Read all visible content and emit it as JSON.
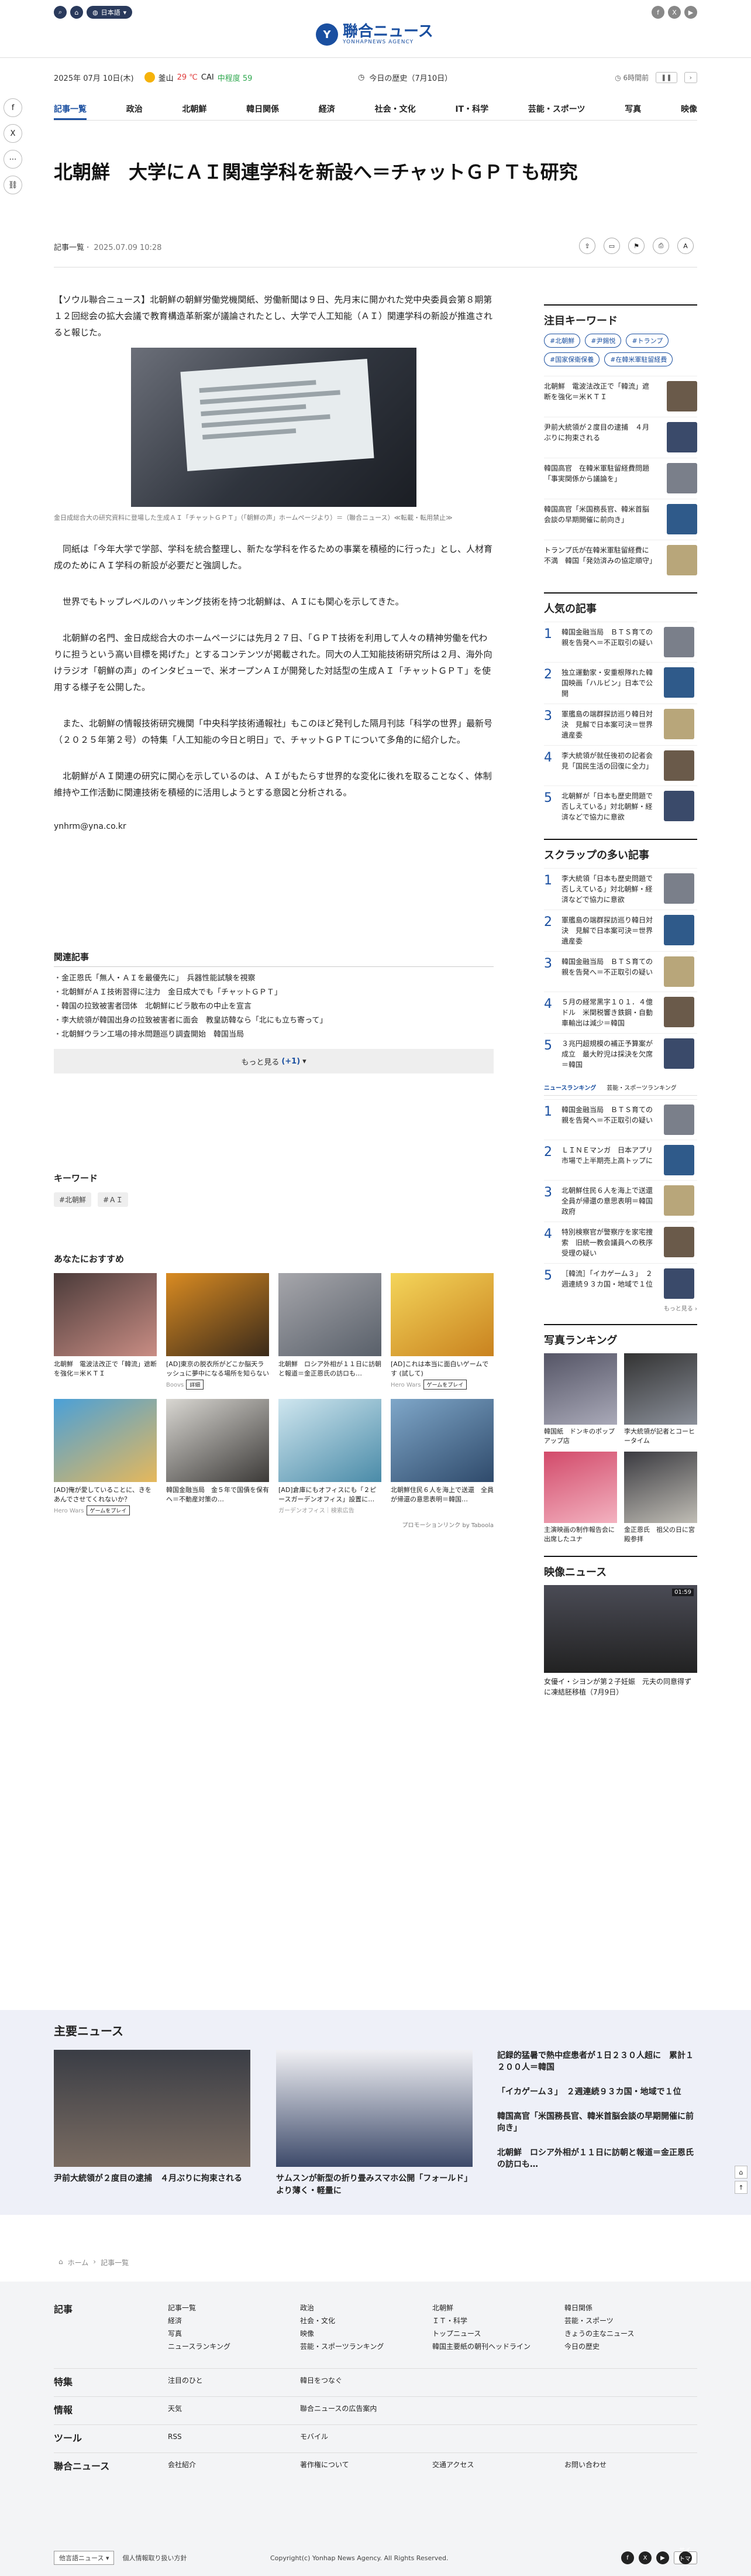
{
  "header": {
    "lang_label": "日本語",
    "logo_text": "聯合ニュース",
    "logo_sub": "YONHAPNEWS AGENCY",
    "date": "2025年 07月 10日(木)",
    "weather_label": "釜山",
    "temp": "29 ℃",
    "cai_label": "CAI",
    "cai_status": "中程度 59",
    "today_history": "今日の歴史（7月10日）",
    "updated": "6時間前"
  },
  "nav": [
    "記事一覧",
    "政治",
    "北朝鮮",
    "韓日関係",
    "経済",
    "社会・文化",
    "IT・科学",
    "芸能・スポーツ",
    "写真",
    "映像"
  ],
  "article": {
    "title": "北朝鮮　大学にＡＩ関連学科を新設へ＝チャットＧＰＴも研究",
    "category": "記事一覧",
    "datetime": "2025.07.09 10:28",
    "lead": "【ソウル聯合ニュース】北朝鮮の朝鮮労働党機関紙、労働新聞は９日、先月末に開かれた党中央委員会第８期第１２回総会の拡大会議で教育構造革新案が議論されたとし、大学で人工知能（ＡＩ）関連学科の新設が推進されると報じた。",
    "caption": "金日成総合大の研究資料に登場した生成ＡＩ「チャットＧＰＴ」（「朝鮮の声」ホームページより）＝（聯合ニュース）≪転載・転用禁止≫",
    "p1": "　同紙は「今年大学で学部、学科を統合整理し、新たな学科を作るための事業を積極的に行った」とし、人材育成のためにＡＩ学科の新設が必要だと強調した。",
    "p2": "　世界でもトップレベルのハッキング技術を持つ北朝鮮は、ＡＩにも関心を示してきた。",
    "p3": "　北朝鮮の名門、金日成総合大のホームページには先月２７日、「ＧＰＴ技術を利用して人々の精神労働を代わりに担うという高い目標を掲げた」とするコンテンツが掲載された。同大の人工知能技術研究所は２月、海外向けラジオ「朝鮮の声」のインタビューで、米オープンＡＩが開発した対話型の生成ＡＩ「チャットＧＰＴ」を使用する様子を公開した。",
    "p4": "　また、北朝鮮の情報技術研究機関「中央科学技術通報社」もこのほど発刊した隔月刊誌「科学の世界」最新号（２０２５年第２号）の特集「人工知能の今日と明日」で、チャットＧＰＴについて多角的に紹介した。",
    "p5": "　北朝鮮がＡＩ関連の研究に関心を示しているのは、ＡＩがもたらす世界的な変化に後れを取ることなく、体制維持や工作活動に関連技術を積極的に活用しようとする意図と分析される。",
    "email": "ynhrm@yna.co.kr"
  },
  "related": {
    "heading": "関連記事",
    "items": [
      "金正恩氏「無人・ＡＩを最優先に」　兵器性能試験を視察",
      "北朝鮮がＡＩ技術習得に注力　金日成大でも「チャットＧＰＴ」",
      "韓国の拉致被害者団体　北朝鮮にビラ散布の中止を宣言",
      "李大統領が韓国出身の拉致被害者に面会　教皇訪韓なら「北にも立ち寄って」",
      "北朝鮮ウラン工場の排水問題巡り調査開始　韓国当局"
    ],
    "more_label": "もっと見る",
    "more_count": "(+1)"
  },
  "keywords": {
    "heading": "キーワード",
    "items": [
      "#北朝鮮",
      "#ＡＩ"
    ]
  },
  "recommend": {
    "heading": "あなたにおすすめ",
    "promo": "プロモーションリンク by Taboola",
    "items": [
      {
        "t": "北朝鮮　電波法改正で「韓流」遮断を強化＝米ＫＴＩ",
        "s": "",
        "btn": ""
      },
      {
        "t": "[AD]東京の脱衣所がどこか脳天ラッシュに夢中になる場所を知らない",
        "s": "Boovs",
        "btn": "詳細"
      },
      {
        "t": "北朝鮮　ロシア外相が１１日に訪朝と報道＝金正恩氏の訪ロも…",
        "s": "",
        "btn": ""
      },
      {
        "t": "[AD]これは本当に面白いゲームです (試して)",
        "s": "Hero Wars",
        "btn": "ゲームをプレイ"
      },
      {
        "t": "[AD]俺が愛していることに、きをあんでさせてくれないか？",
        "s": "Hero Wars",
        "btn": "ゲームをプレイ"
      },
      {
        "t": "韓国金融当局　金５年で国債を保有へ＝不動産対策の…",
        "s": "",
        "btn": ""
      },
      {
        "t": "[AD]倉庫にもオフィスにも「２ピースガーデンオフィス」設置に…",
        "s": "ガーデンオフィス｜検索広告",
        "btn": ""
      },
      {
        "t": "北朝鮮住民６人を海上で送還　全員が帰還の意思表明＝韓国…",
        "s": "",
        "btn": ""
      }
    ]
  },
  "side": {
    "kw_heading": "注目キーワード",
    "tags": [
      "#北朝鮮",
      "#尹錫悦",
      "#トランプ",
      "#国家保衛保養",
      "#在韓米軍駐留経費"
    ],
    "kw_items": [
      "北朝鮮　電波法改正で「韓流」遮断を強化＝米ＫＴＩ",
      "尹前大統領が２度目の逮捕　４月ぶりに拘束される",
      "韓国高官　在韓米軍駐留経費問題「事実関係から議論を」",
      "韓国高官「米国務長官、韓米首脳会談の早期開催に前向き」",
      "トランプ氏が在韓米軍駐留経費に不満　韓国「発効済みの協定順守」"
    ],
    "pop_heading": "人気の記事",
    "popular": [
      "韓国金融当局　ＢＴＳ育ての親を告発へ＝不正取引の疑い",
      "独立運動家・安重根隊れた韓国映画「ハルビン」日本で公開",
      "軍艦島の端群探訪巡り韓日対決　見解で日本案可決＝世界遺産委",
      "李大統領が就任後初の記者会見「国民生活の回復に全力」",
      "北朝鮮が「日本も歴史問題で否しえている」対北朝鮮・経済などで協力に意欲"
    ],
    "scrap_heading": "スクラップの多い記事",
    "scrap": [
      "李大統領「日本も歴史問題で否しえている」対北朝鮮・経済などで協力に意欲",
      "軍艦島の端群探訪巡り韓日対決　見解で日本案可決＝世界遺産委",
      "韓国金融当局　ＢＴＳ育ての親を告発へ＝不正取引の疑い",
      "５月の経常黒字１０１．４億ドル　米関税響き鉄鋼・自動車輸出は減少＝韓国",
      "３兆円超規模の補正予算案が成立　最大貯児は採決を欠席＝韓国"
    ],
    "tab_news": "ニュースランキング",
    "tab_sports": "芸能・スポーツランキング",
    "ranking": [
      "韓国金融当局　ＢＴＳ育ての親を告発へ＝不正取引の疑い",
      "ＬＩＮＥマンガ　日本アプリ市場で上半期売上高トップに",
      "北朝鮮住民６人を海上で送還　全員が帰還の意思表明＝韓国政府",
      "特別検察官が警察庁を家宅捜索　旧統一教会議員への秩序受理の疑い",
      "［韓流］「イカゲーム３」　２週連続９３カ国・地域で１位"
    ],
    "more_link": "もっと見る",
    "photo_heading": "写真ランキング",
    "photos": [
      "韓国紙　ドンキのポップアップ店",
      "李大統領が記者とコーヒータイム",
      "主演映画の制作報告会に出席したユナ",
      "金正恩氏　祖父の日に宮殿参拝"
    ],
    "video_heading": "映像ニュース",
    "video_dur": "01:59",
    "video_title": "女優イ・シヨンが第２子妊娠　元夫の同意得ずに凍結胚移植（7月9日）"
  },
  "main_news": {
    "heading": "主要ニュース",
    "cards": [
      "尹前大統領が２度目の逮捕　４月ぶりに拘束される",
      "サムスンが新型の折り畳みスマホ公開「フォールド」より薄く・軽量に"
    ],
    "list": [
      "記録的猛暑で熱中症患者が１日２３０人超に　累計１２００人＝韓国",
      "「イカゲーム３」　２週連続９３カ国・地域で１位",
      "韓国高官「米国務長官、韓米首脳会談の早期開催に前向き」",
      "北朝鮮　ロシア外相が１１日に訪朝と報道＝金正恩氏の訪ロも…"
    ]
  },
  "breadcrumb": {
    "home": "ホーム",
    "current": "記事一覧"
  },
  "footer": {
    "rows": [
      {
        "h": "記事",
        "cols": [
          "記事一覧\n経済\n写真\nニュースランキング",
          "政治\n社会・文化\n映像\n芸能・スポーツランキング",
          "北朝鮮\nＩＴ・科学\nトップニュース\n韓国主要紙の朝刊ヘッドライン",
          "韓日関係\n芸能・スポーツ\nきょうの主なニュース\n今日の歴史"
        ]
      },
      {
        "h": "特集",
        "cols": [
          "注目のひと",
          "韓日をつなぐ",
          "",
          ""
        ]
      },
      {
        "h": "情報",
        "cols": [
          "天気",
          "聯合ニュースの広告案内",
          "",
          ""
        ]
      },
      {
        "h": "ツール",
        "cols": [
          "RSS",
          "モバイル",
          "",
          ""
        ]
      },
      {
        "h": "聯合ニュース",
        "cols": [
          "会社紹介",
          "著作権について",
          "交通アクセス",
          "お問い合わせ"
        ]
      }
    ],
    "site_select": "他言語ニュース",
    "privacy": "個人情報取り扱い方針",
    "copyright": "Copyright(c) Yonhap News Agency. All Rights Reserved.",
    "sitemap": "サイトマップ"
  }
}
